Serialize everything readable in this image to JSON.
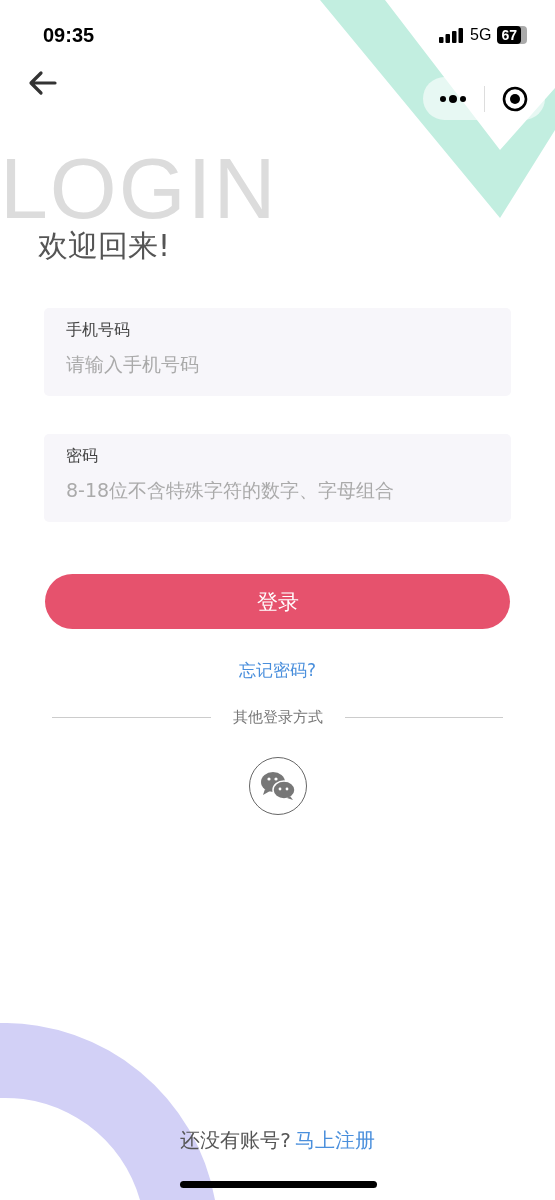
{
  "status_bar": {
    "time": "09:35",
    "network": "5G",
    "battery": "67"
  },
  "background_text": "LOGIN",
  "title": "欢迎回来!",
  "fields": [
    {
      "label": "手机号码",
      "placeholder": "请输入手机号码"
    },
    {
      "label": "密码",
      "placeholder": "8-18位不含特殊字符的数字、字母组合"
    }
  ],
  "login_button": "登录",
  "forgot_link": "忘记密码?",
  "divider_text": "其他登录方式",
  "footer": {
    "text": "还没有账号?",
    "link": "马上注册"
  }
}
